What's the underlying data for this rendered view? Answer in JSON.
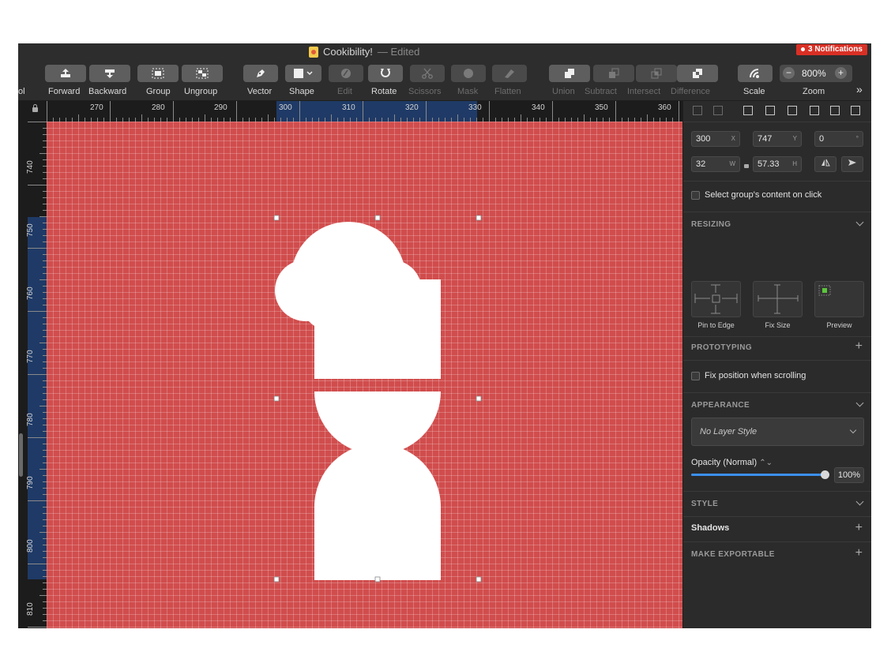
{
  "window": {
    "title": "Cookibility!",
    "status": "— Edited",
    "notifications": "3 Notifications",
    "notification_color": "#d93025"
  },
  "toolbar": {
    "left_clip": "ol",
    "buttons": [
      {
        "label": "Forward",
        "icon": "bring-forward-icon",
        "enabled": true
      },
      {
        "label": "Backward",
        "icon": "send-backward-icon",
        "enabled": true
      },
      {
        "label": "Group",
        "icon": "group-icon",
        "enabled": true
      },
      {
        "label": "Ungroup",
        "icon": "ungroup-icon",
        "enabled": true
      },
      {
        "label": "Vector",
        "icon": "pen-icon",
        "enabled": true
      },
      {
        "label": "Shape",
        "icon": "square-icon",
        "enabled": true
      },
      {
        "label": "Edit",
        "icon": "edit-icon",
        "enabled": false
      },
      {
        "label": "Rotate",
        "icon": "rotate-icon",
        "enabled": true
      },
      {
        "label": "Scissors",
        "icon": "scissors-icon",
        "enabled": false
      },
      {
        "label": "Mask",
        "icon": "mask-icon",
        "enabled": false
      },
      {
        "label": "Flatten",
        "icon": "flatten-icon",
        "enabled": false
      },
      {
        "label": "Union",
        "icon": "union-icon",
        "enabled": true
      },
      {
        "label": "Subtract",
        "icon": "subtract-icon",
        "enabled": false
      },
      {
        "label": "Intersect",
        "icon": "intersect-icon",
        "enabled": false
      },
      {
        "label": "Difference",
        "icon": "difference-icon",
        "enabled": true
      },
      {
        "label": "Scale",
        "icon": "scale-icon",
        "enabled": true
      }
    ],
    "zoom_label": "Zoom",
    "zoom_value": "800%",
    "zoom_minus": "−",
    "zoom_plus": "+",
    "more": "»"
  },
  "rulers": {
    "horizontal": [
      "270",
      "280",
      "290",
      "300",
      "310",
      "320",
      "330",
      "340",
      "350",
      "360"
    ],
    "vertical": [
      "740",
      "750",
      "760",
      "770",
      "780",
      "790",
      "800",
      "810"
    ]
  },
  "canvas": {
    "background_color": "#d14d4d",
    "artwork_color": "#ffffff"
  },
  "inspector": {
    "x": {
      "value": "300",
      "unit": "X"
    },
    "y": {
      "value": "747",
      "unit": "Y"
    },
    "rotation": {
      "value": "0",
      "unit": "°"
    },
    "w": {
      "value": "32",
      "unit": "W"
    },
    "h": {
      "value": "57.33",
      "unit": "H"
    },
    "select_group_content": "Select group's content on click",
    "resizing": "RESIZING",
    "pin_to_edge": "Pin to Edge",
    "fix_size": "Fix Size",
    "preview": "Preview",
    "prototyping": "PROTOTYPING",
    "fix_position": "Fix position when scrolling",
    "appearance": "APPEARANCE",
    "layer_style": "No Layer Style",
    "opacity_label": "Opacity (Normal)",
    "opacity_value": "100%",
    "opacity_fraction": 1.0,
    "style": "STYLE",
    "shadows": "Shadows",
    "make_exportable": "MAKE EXPORTABLE",
    "accent_color": "#3c8ff0"
  }
}
